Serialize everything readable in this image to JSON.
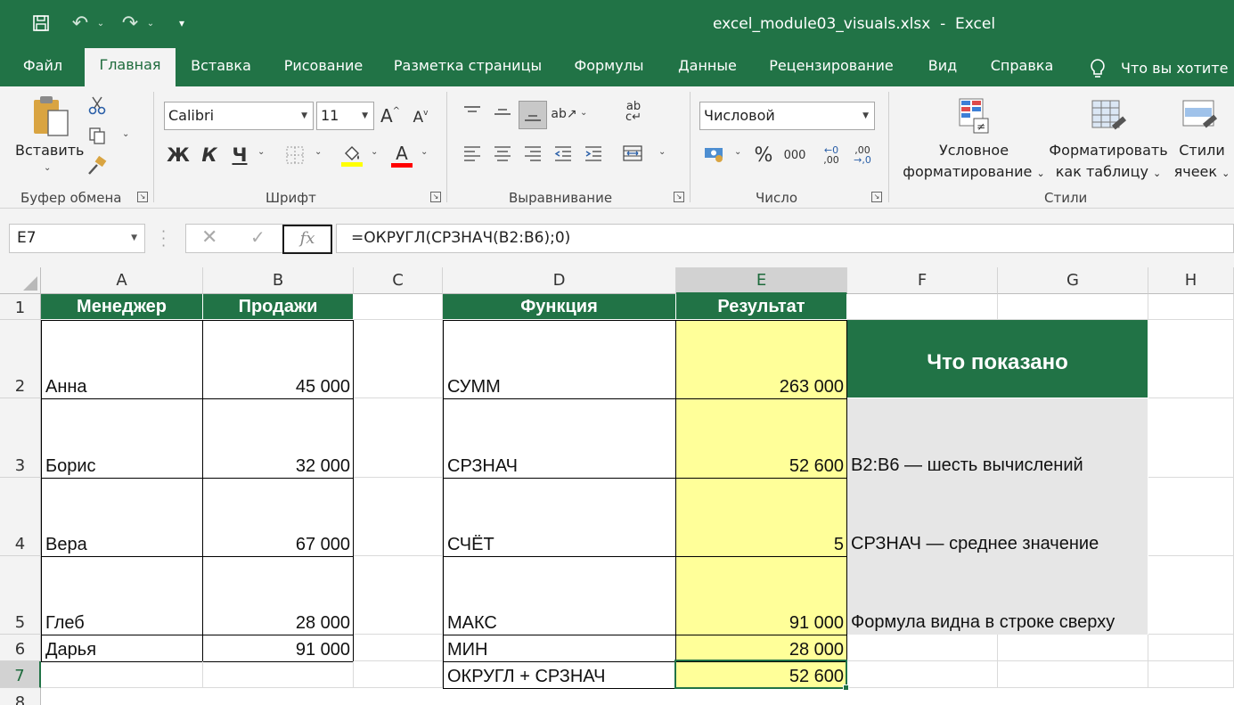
{
  "titlebar": {
    "title": "excel_module03_visuals.xlsx  -  Excel",
    "save_icon": "save-icon",
    "undo_icon": "undo-icon",
    "redo_icon": "redo-icon"
  },
  "tabs": [
    {
      "label": "Файл"
    },
    {
      "label": "Главная"
    },
    {
      "label": "Вставка"
    },
    {
      "label": "Рисование"
    },
    {
      "label": "Разметка страницы"
    },
    {
      "label": "Формулы"
    },
    {
      "label": "Данные"
    },
    {
      "label": "Рецензирование"
    },
    {
      "label": "Вид"
    },
    {
      "label": "Справка"
    }
  ],
  "tellme": "Что вы хотите",
  "ribbon": {
    "clipboard": {
      "paste_label": "Вставить",
      "group_label": "Буфер обмена"
    },
    "font": {
      "family": "Calibri",
      "size": "11",
      "bold": "Ж",
      "italic": "К",
      "underline": "Ч",
      "group_label": "Шрифт",
      "fill_color": "#ffff00",
      "font_color": "#ff0000"
    },
    "alignment": {
      "group_label": "Выравнивание"
    },
    "number": {
      "format": "Числовой",
      "percent": "%",
      "thousands": "000",
      "inc_decimal": ",00",
      "dec_decimal": ",00",
      "group_label": "Число"
    },
    "styles": {
      "conditional_line1": "Условное",
      "conditional_line2": "форматирование",
      "table_line1": "Форматировать",
      "table_line2": "как таблицу",
      "cell_line1": "Стили",
      "cell_line2": "ячеек",
      "group_label": "Стили"
    }
  },
  "formula_bar": {
    "name_box": "E7",
    "formula": "=ОКРУГЛ(СРЗНАЧ(B2:B6);0)",
    "cancel": "✕",
    "enter": "✓",
    "fx": "fx"
  },
  "grid": {
    "columns": [
      "A",
      "B",
      "C",
      "D",
      "E",
      "F",
      "G",
      "H"
    ],
    "rows": [
      "1",
      "2",
      "3",
      "4",
      "5",
      "6",
      "7",
      "8"
    ],
    "a1": "Менеджер",
    "b1": "Продажи",
    "d1": "Функция",
    "e1": "Результат",
    "managers": [
      "Анна",
      "Борис",
      "Вера",
      "Глеб",
      "Дарья"
    ],
    "sales": [
      "45 000",
      "32 000",
      "67 000",
      "28 000",
      "91 000"
    ],
    "functions": [
      "СУММ",
      "СРЗНАЧ",
      "СЧЁТ",
      "МАКС",
      "МИН",
      "ОКРУГЛ + СРЗНАЧ"
    ],
    "results": [
      "263 000",
      "52 600",
      "5",
      "91 000",
      "28 000",
      "52 600"
    ],
    "note_title": "Что показано",
    "notes": [
      "B2:B6 — шесть вычислений",
      "СРЗНАЧ — среднее значение",
      "Формула видна в строке сверху"
    ]
  },
  "colors": {
    "excel_green": "#217346",
    "result_yellow": "#ffff99",
    "note_gray": "#e6e6e6"
  }
}
